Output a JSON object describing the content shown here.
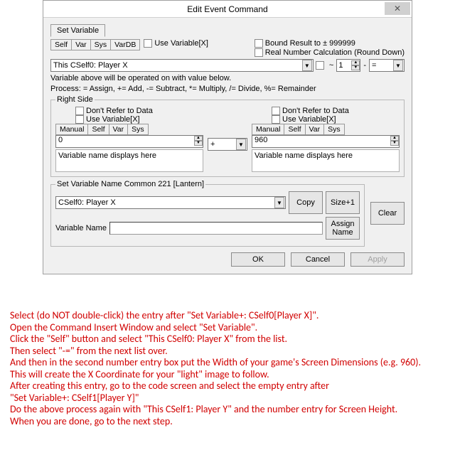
{
  "dialog": {
    "title": "Edit Event Command",
    "tab": "Set Variable",
    "scope_tabs": [
      "Self",
      "Var",
      "Sys",
      "VarDB"
    ],
    "use_variable_x": "Use Variable[X]",
    "bound_result": "Bound Result to ± 999999",
    "real_number": "Real Number Calculation (Round Down)",
    "target_var": "This CSelf0: Player X",
    "tilde": "~",
    "spin_value": "1",
    "dash": "-",
    "op_combo": "=",
    "help1": "Variable above will be operated on with value below.",
    "help2": "Process: = Assign, += Add, -= Subtract, *= Multiply, /= Divide, %= Remainder",
    "right_side": {
      "legend": "Right Side",
      "dont_refer": "Don't Refer to Data",
      "use_var_x": "Use Variable[X]",
      "mode_tabs": [
        "Manual",
        "Self",
        "Var",
        "Sys"
      ],
      "left_value": "0",
      "mid_op": "+",
      "right_value": "960",
      "disp_text": "Variable name displays here"
    },
    "set_var_name": {
      "legend": "Set Variable Name  Common 221 [Lantern]",
      "combo": "CSelf0: Player X",
      "copy": "Copy",
      "size_plus": "Size+1",
      "var_name_label": "Variable Name",
      "assign": "Assign Name",
      "clear": "Clear"
    },
    "buttons": {
      "ok": "OK",
      "cancel": "Cancel",
      "apply": "Apply"
    }
  },
  "instructions": {
    "l1": "Select (do NOT double-click) the entry after \"Set Variable+: CSelf0[Player X]\".",
    "l2": "Open the Command Insert Window and select \"Set Variable\".",
    "l3": "Click the \"Self\" button and select \"This CSelf0: Player X\" from the list.",
    "l4": "Then select \"-=\" from the next list over.",
    "l5": "And then in the second number entry box put the Width of your game's Screen Dimensions (e.g. 960).",
    "l6": "This will create the X Coordinate for your \"light\" image to follow.",
    "l7": "After creating this entry, go to the code screen and select the empty entry after",
    "l8": "\"Set Variable+: CSelf1[Player Y]\"",
    "l9": "Do the above process again with \"This CSelf1: Player Y\" and the number entry for Screen Height.",
    "l10": "When you are done, go to the next step."
  }
}
